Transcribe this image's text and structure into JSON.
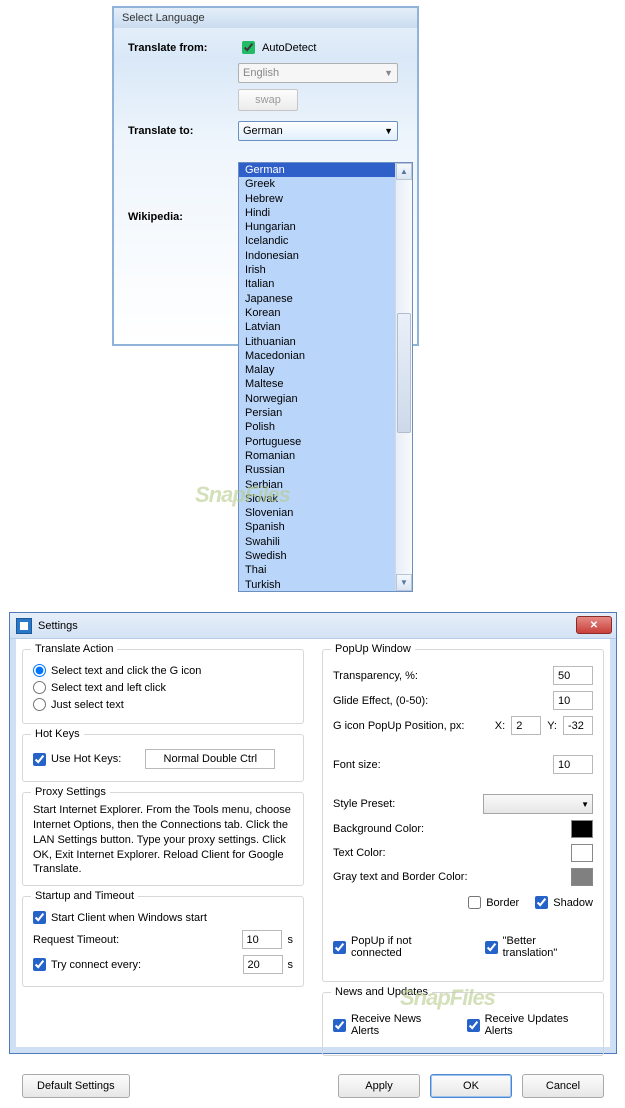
{
  "lang": {
    "title": "Select Language",
    "from_label": "Translate from:",
    "autodetect": "AutoDetect",
    "from_dd": "English",
    "swap": "swap",
    "to_label": "Translate to:",
    "to_dd": "German",
    "wiki_label": "Wikipedia:",
    "options": [
      "German",
      "Greek",
      "Hebrew",
      "Hindi",
      "Hungarian",
      "Icelandic",
      "Indonesian",
      "Irish",
      "Italian",
      "Japanese",
      "Korean",
      "Latvian",
      "Lithuanian",
      "Macedonian",
      "Malay",
      "Maltese",
      "Norwegian",
      "Persian",
      "Polish",
      "Portuguese",
      "Romanian",
      "Russian",
      "Serbian",
      "Slovak",
      "Slovenian",
      "Spanish",
      "Swahili",
      "Swedish",
      "Thai",
      "Turkish"
    ]
  },
  "watermark": "SnapFiles",
  "settings": {
    "title": "Settings",
    "translate_action": {
      "title": "Translate Action",
      "opt1": "Select text and click the G icon",
      "opt2": "Select text and left click",
      "opt3": "Just select text"
    },
    "hotkeys": {
      "title": "Hot Keys",
      "use": "Use Hot Keys:",
      "value": "Normal Double Ctrl"
    },
    "proxy": {
      "title": "Proxy Settings",
      "text": "Start Internet Explorer. From the Tools menu, choose Internet Options, then the Connections tab. Click the LAN Settings button. Type your proxy settings. Click OK, Exit Internet Explorer. Reload Client for Google Translate."
    },
    "startup": {
      "title": "Startup and Timeout",
      "start": "Start Client when Windows start",
      "req": "Request Timeout:",
      "req_val": "10",
      "try": "Try connect every:",
      "try_val": "20",
      "unit": "s"
    },
    "popup": {
      "title": "PopUp Window",
      "transp": "Transparency, %:",
      "transp_val": "50",
      "glide": "Glide Effect, (0-50):",
      "glide_val": "10",
      "pos": "G icon PopUp Position, px:",
      "x": "X:",
      "x_val": "2",
      "y": "Y:",
      "y_val": "-32",
      "font": "Font size:",
      "font_val": "10",
      "style": "Style Preset:",
      "bg": "Background Color:",
      "txt": "Text Color:",
      "gray": "Gray text and Border Color:",
      "border": "Border",
      "shadow": "Shadow",
      "ifnot": "PopUp if not connected",
      "better": "\"Better translation\""
    },
    "news": {
      "title": "News and Updates",
      "r1": "Receive News Alerts",
      "r2": "Receive Updates Alerts"
    },
    "buttons": {
      "default": "Default Settings",
      "apply": "Apply",
      "ok": "OK",
      "cancel": "Cancel"
    }
  }
}
